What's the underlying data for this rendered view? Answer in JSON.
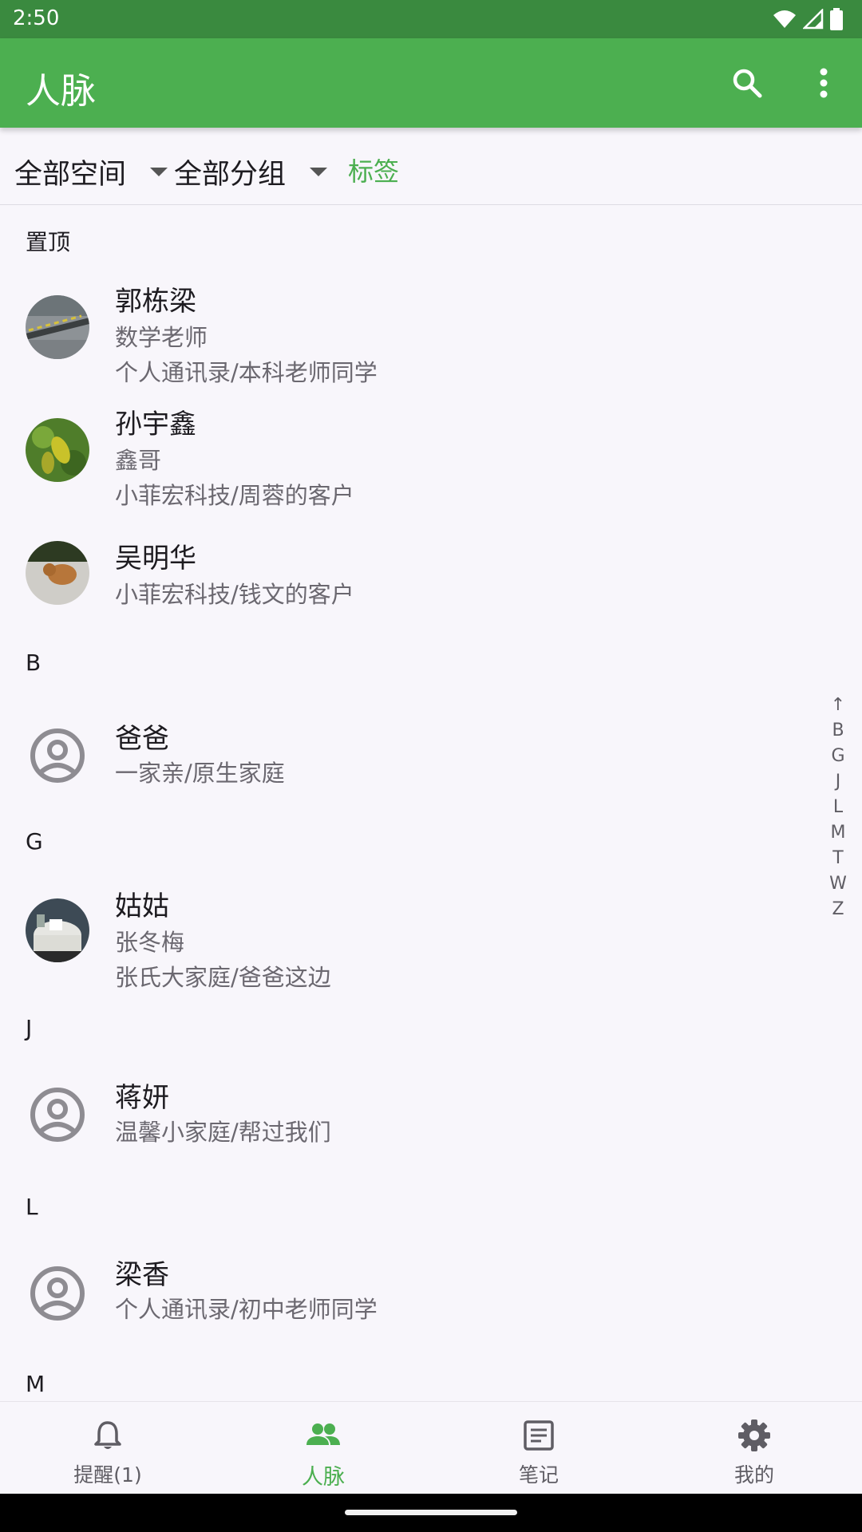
{
  "status": {
    "time": "2:50"
  },
  "appbar": {
    "title": "人脉"
  },
  "filters": {
    "space": "全部空间",
    "group": "全部分组",
    "tags": "标签"
  },
  "sections": {
    "pinned": "置顶",
    "b": "B",
    "g": "G",
    "j": "J",
    "l": "L",
    "m": "M"
  },
  "contacts": [
    {
      "name": "郭栋梁",
      "note": "数学老师",
      "group": "个人通讯录/本科老师同学",
      "avatar": "photo-road"
    },
    {
      "name": "孙宇鑫",
      "note": "鑫哥",
      "group": "小菲宏科技/周蓉的客户",
      "avatar": "photo-leaves"
    },
    {
      "name": "吴明华",
      "group": "小菲宏科技/钱文的客户",
      "avatar": "photo-cat"
    },
    {
      "name": "爸爸",
      "group": "一家亲/原生家庭",
      "avatar": "default-person-icon"
    },
    {
      "name": "姑姑",
      "note": "张冬梅",
      "group": "张氏大家庭/爸爸这边",
      "avatar": "photo-table"
    },
    {
      "name": "蒋妍",
      "group": "温馨小家庭/帮过我们",
      "avatar": "default-person-icon"
    },
    {
      "name": "梁香",
      "group": "个人通讯录/初中老师同学",
      "avatar": "default-person-icon"
    }
  ],
  "index_letters": [
    "↑",
    "B",
    "G",
    "J",
    "L",
    "M",
    "T",
    "W",
    "Z"
  ],
  "bottom_nav": [
    {
      "label": "提醒(1)",
      "icon": "bell-icon"
    },
    {
      "label": "人脉",
      "icon": "people-icon",
      "active": true
    },
    {
      "label": "笔记",
      "icon": "note-icon"
    },
    {
      "label": "我的",
      "icon": "gear-icon"
    }
  ],
  "colors": {
    "primary": "#4caf50",
    "status_bar": "#3a8a3f",
    "secondary_text": "#6b6870"
  }
}
